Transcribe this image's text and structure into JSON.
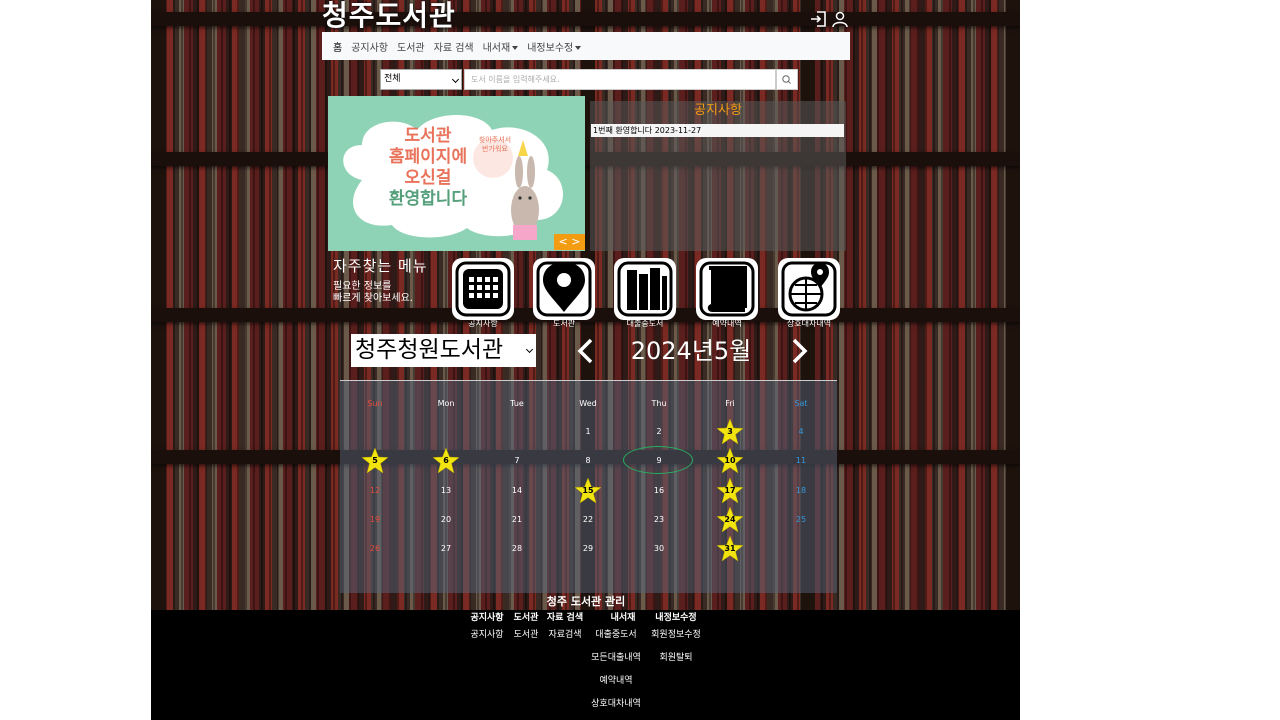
{
  "header": {
    "site_title": "청주도서관",
    "login_icon": "login-icon",
    "user_icon": "user-icon"
  },
  "nav": {
    "home": "홈",
    "notice": "공지사항",
    "library": "도서관",
    "search": "자료 검색",
    "my_library": "내서재",
    "edit_info": "내정보수정"
  },
  "search": {
    "category": "전체",
    "placeholder": "도서 이름을 입력해주세요.",
    "button_icon": "search-icon"
  },
  "banner": {
    "line1": "도서관",
    "line2": "홈페이지에",
    "line3": "오신걸",
    "line4": "환영합니다",
    "bubble": "찾아주셔서 반가워요",
    "controls": "< >"
  },
  "notice_panel": {
    "title": "공지사항",
    "items": [
      {
        "text": "1번째 환영합니다 2023-11-27"
      }
    ]
  },
  "favorites": {
    "title": "자주찾는 메뉴",
    "subtitle_line1": "필요한 정보를",
    "subtitle_line2": "빠르게 찾아보세요.",
    "items": [
      {
        "label": "공지사항",
        "icon": "calendar-icon"
      },
      {
        "label": "도서관",
        "icon": "map-pin-icon"
      },
      {
        "label": "대출중도서",
        "icon": "books-icon"
      },
      {
        "label": "예약내역",
        "icon": "book-icon"
      },
      {
        "label": "상호대차내역",
        "icon": "globe-pin-icon"
      }
    ]
  },
  "calendar": {
    "library": "청주청원도서관",
    "month_title": "2024년5월",
    "weekdays": [
      "Sun",
      "Mon",
      "Tue",
      "Wed",
      "Thu",
      "Fri",
      "Sat"
    ],
    "days": [
      "1",
      "2",
      "3",
      "4",
      "5",
      "6",
      "7",
      "8",
      "9",
      "10",
      "11",
      "12",
      "13",
      "14",
      "15",
      "16",
      "17",
      "18",
      "19",
      "20",
      "21",
      "22",
      "23",
      "24",
      "25",
      "26",
      "27",
      "28",
      "29",
      "30",
      "31"
    ],
    "starred_days": [
      "3",
      "5",
      "6",
      "10",
      "15",
      "17",
      "24",
      "31"
    ],
    "today": "9",
    "colors": {
      "sunday": "#e74c3c",
      "saturday": "#3498db",
      "star": "#f1e40f",
      "today_ring": "#27ae60"
    }
  },
  "footer": {
    "title": "청주 도서관 관리",
    "columns": [
      {
        "heading": "공지사항",
        "links": [
          "공지사항"
        ]
      },
      {
        "heading": "도서관",
        "links": [
          "도서관"
        ]
      },
      {
        "heading": "자료 검색",
        "links": [
          "자료검색"
        ]
      },
      {
        "heading": "내서재",
        "links": [
          "대출중도서",
          "모든대출내역",
          "예약내역",
          "상호대차내역"
        ]
      },
      {
        "heading": "내정보수정",
        "links": [
          "회원정보수정",
          "회원탈퇴"
        ]
      }
    ]
  },
  "theme": {
    "accent": "#f39c12",
    "nav_bg": "#f8f9fa"
  }
}
